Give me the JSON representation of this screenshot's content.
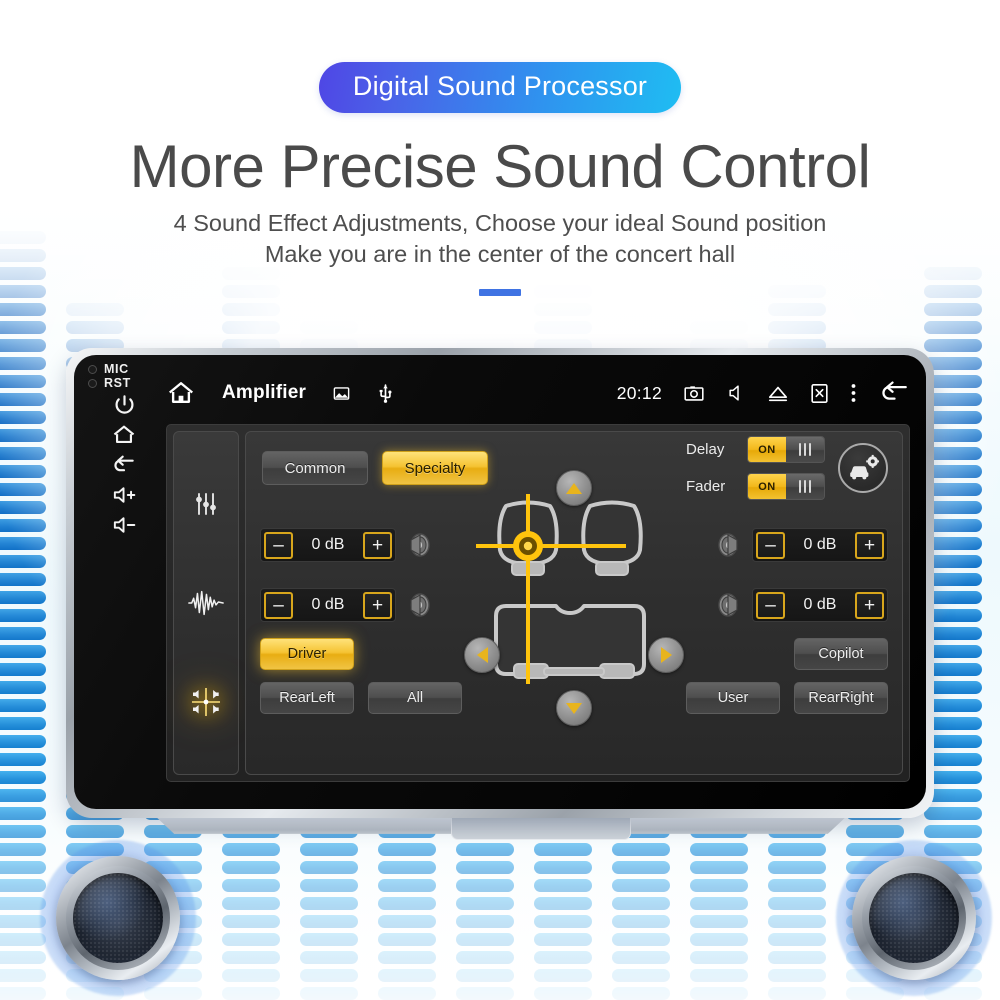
{
  "header": {
    "badge": "Digital Sound Processor",
    "title": "More Precise Sound Control",
    "subtitle_line1": "4 Sound Effect Adjustments, Choose your ideal Sound position",
    "subtitle_line2": "Make you are in the center of the concert hall",
    "badge_gradient_from": "#4f46e5",
    "badge_gradient_to": "#1fbdf2",
    "divider_color": "#3f73e3"
  },
  "device": {
    "hardware_buttons": [
      {
        "name": "mic",
        "label": "MIC",
        "type": "hole-label"
      },
      {
        "name": "rst",
        "label": "RST",
        "type": "hole-label"
      },
      {
        "name": "power",
        "label": "",
        "icon": "power-icon"
      },
      {
        "name": "home",
        "label": "",
        "icon": "home-icon"
      },
      {
        "name": "back",
        "label": "",
        "icon": "back-arrow-icon"
      },
      {
        "name": "volume-up",
        "label": "",
        "icon": "volume-up-icon"
      },
      {
        "name": "volume-down",
        "label": "",
        "icon": "volume-down-icon"
      }
    ]
  },
  "statusbar": {
    "home_icon": "home-icon",
    "title": "Amplifier",
    "gallery_icon": "image-icon",
    "usb_icon": "usb-icon",
    "time": "20:12",
    "camera_icon": "camera-icon",
    "mute_icon": "speaker-mute-icon",
    "eject_icon": "eject-icon",
    "screen_off_icon": "screen-off-icon",
    "overflow_icon": "more-vertical-icon",
    "back_icon": "back-arrow-icon"
  },
  "sidebar": {
    "items": [
      {
        "name": "equalizer",
        "icon": "sliders-icon",
        "active": false
      },
      {
        "name": "sound-effect",
        "icon": "waveform-icon",
        "active": false
      },
      {
        "name": "balance-fader",
        "icon": "balance-speakers-icon",
        "active": true
      }
    ]
  },
  "amplifier": {
    "tabs": [
      {
        "label": "Common",
        "selected": false
      },
      {
        "label": "Specialty",
        "selected": true
      }
    ],
    "toggles": [
      {
        "label": "Delay",
        "state": "ON"
      },
      {
        "label": "Fader",
        "state": "ON"
      }
    ],
    "settings_icon": "car-gear-icon",
    "channels": [
      {
        "name": "front-left",
        "position": "left-top",
        "value": "0 dB"
      },
      {
        "name": "rear-left",
        "position": "left-bottom",
        "value": "0 dB"
      },
      {
        "name": "front-right",
        "position": "right-top",
        "value": "0 dB"
      },
      {
        "name": "rear-right",
        "position": "right-bottom",
        "value": "0 dB"
      }
    ],
    "stepper_minus": "–",
    "stepper_plus": "+",
    "pads": [
      {
        "name": "pad-up",
        "direction": "up"
      },
      {
        "name": "pad-down",
        "direction": "down"
      },
      {
        "name": "pad-left",
        "direction": "left"
      },
      {
        "name": "pad-right",
        "direction": "right"
      }
    ],
    "presets": [
      {
        "label": "Driver",
        "selected": true
      },
      {
        "label": "RearLeft",
        "selected": false
      },
      {
        "label": "All",
        "selected": false
      },
      {
        "label": "User",
        "selected": false
      },
      {
        "label": "Copilot",
        "selected": false
      },
      {
        "label": "RearRight",
        "selected": false
      }
    ],
    "accent_gold": "#f2b81b",
    "panel_bg": "#2e2e2e"
  },
  "decor": {
    "speaker_left": "speaker-driver-icon",
    "speaker_right": "speaker-driver-icon",
    "eq_bar_color_dark": "#1f6fc4",
    "eq_bar_color_light": "#29a8e8"
  }
}
